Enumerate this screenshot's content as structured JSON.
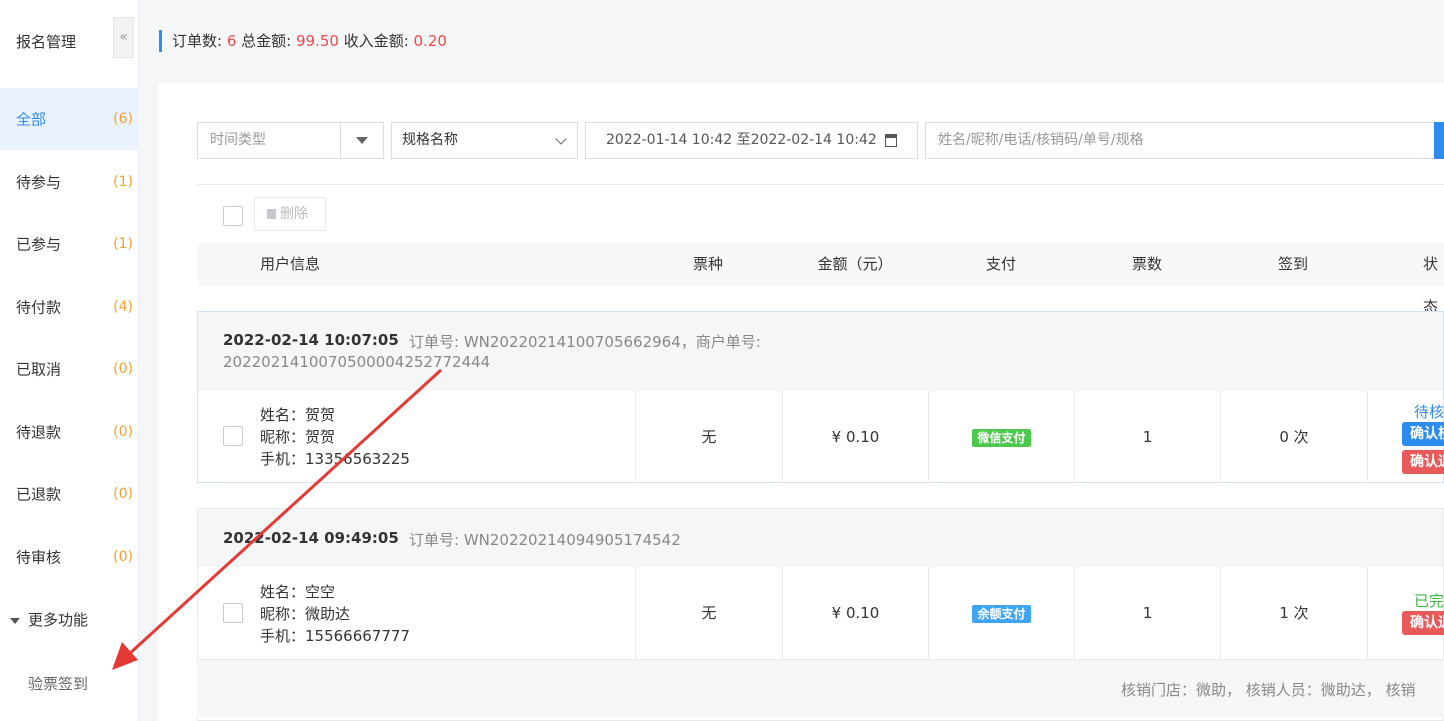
{
  "sidebar": {
    "title": "报名管理",
    "collapse_icon": "«",
    "items": [
      {
        "label": "全部",
        "count": "(6)"
      },
      {
        "label": "待参与",
        "count": "(1)"
      },
      {
        "label": "已参与",
        "count": "(1)"
      },
      {
        "label": "待付款",
        "count": "(4)"
      },
      {
        "label": "已取消",
        "count": "(0)"
      },
      {
        "label": "待退款",
        "count": "(0)"
      },
      {
        "label": "已退款",
        "count": "(0)"
      },
      {
        "label": "待审核",
        "count": "(0)"
      }
    ],
    "more_label": "更多功能",
    "sub_item": "验票签到"
  },
  "summary": {
    "orders_label": "订单数: ",
    "orders": "6",
    "total_label": " 总金额: ",
    "total": "99.50",
    "income_label": " 收入金额: ",
    "income": "0.20"
  },
  "filters": {
    "time_type_placeholder": "时间类型",
    "spec_value": "规格名称",
    "date_range": "2022-01-14 10:42 至2022-02-14 10:42",
    "search_placeholder": "姓名/昵称/电话/核销码/单号/规格"
  },
  "toolbar": {
    "delete_label": "删除"
  },
  "table": {
    "headers": [
      "用户信息",
      "票种",
      "金额（元）",
      "支付",
      "票数",
      "签到",
      "状态"
    ]
  },
  "orders": [
    {
      "time": "2022-02-14 10:07:05",
      "order_no": "订单号: WN20220214100705662964，商户单号:",
      "merchant_no": "2022021410070500004252772444",
      "name": "姓名：贺贺",
      "nickname": "昵称：贺贺",
      "phone": "手机：13356563225",
      "ticket_type": "无",
      "amount": "¥ 0.10",
      "payment": "微信支付",
      "tickets": "1",
      "checkin": "0 次",
      "status": "待核",
      "btn1": "确认核",
      "btn2": "确认退"
    },
    {
      "time": "2022-02-14 09:49:05",
      "order_no": "订单号: WN20220214094905174542",
      "name": "姓名：空空",
      "nickname": "昵称：微助达",
      "phone": "手机：15566667777",
      "ticket_type": "无",
      "amount": "¥ 0.10",
      "payment": "余额支付",
      "tickets": "1",
      "checkin": "1 次",
      "status": "已完",
      "btn1": "确认退",
      "footer": "核销门店：微助，  核销人员：微助达，  核销"
    }
  ],
  "colors": {
    "accent": "#2d8cf0",
    "red": "#ed4a4a",
    "orange": "#f0a22e",
    "wechat": "#4cc84c",
    "balance": "#41a5f5"
  }
}
